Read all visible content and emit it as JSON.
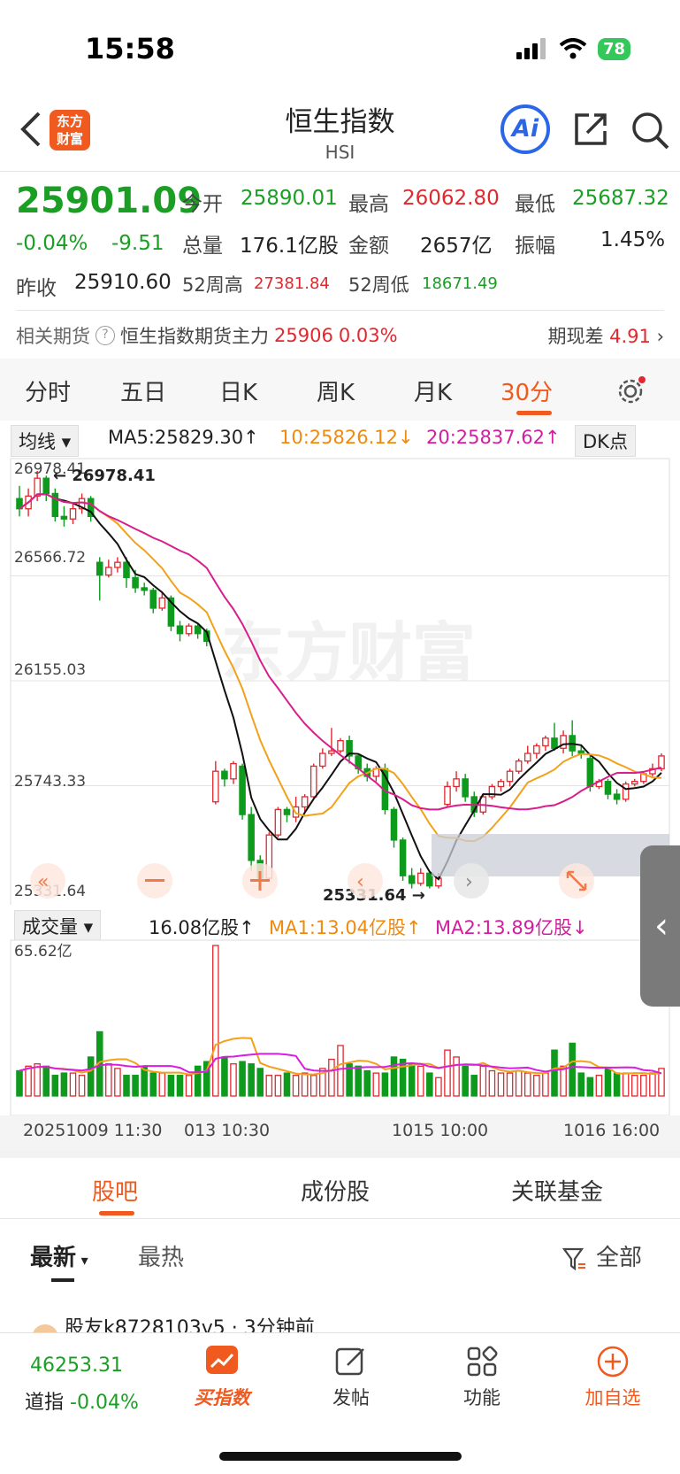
{
  "status_bar": {
    "time": "15:58",
    "battery": "78"
  },
  "header": {
    "logo_line1": "东方",
    "logo_line2": "财富",
    "title": "恒生指数",
    "subtitle": "HSI",
    "ai_label": "Ai"
  },
  "quote": {
    "price": "25901.09",
    "change_pct": "-0.04%",
    "change_abs": "-9.51",
    "open_label": "今开",
    "open": "25890.01",
    "high_label": "最高",
    "high": "26062.80",
    "low_label": "最低",
    "low": "25687.32",
    "volume_label": "总量",
    "volume": "176.1亿股",
    "amount_label": "金额",
    "amount": "2657亿",
    "amplitude_label": "振幅",
    "amplitude": "1.45%",
    "prev_close_label": "昨收",
    "prev_close": "25910.60",
    "wk52_high_label": "52周高",
    "wk52_high": "27381.84",
    "wk52_low_label": "52周低",
    "wk52_low": "18671.49"
  },
  "futures": {
    "label": "相关期货",
    "help": "?",
    "name": "恒生指数期货主力",
    "price": "25906",
    "pct": "0.03%",
    "basis_label": "期现差",
    "basis": "4.91"
  },
  "chart_tabs": [
    "分时",
    "五日",
    "日K",
    "周K",
    "月K",
    "30分"
  ],
  "indicators": {
    "ma_selector": "均线",
    "ma5": "MA5:25829.30↑",
    "ma10": "10:25826.12↓",
    "ma20": "20:25837.62↑",
    "dk": "DK点",
    "vol_selector": "成交量",
    "vol_value": "16.08亿股↑",
    "vol_ma1": "MA1:13.04亿股↑",
    "vol_ma2": "MA2:13.89亿股↓"
  },
  "chart_labels": {
    "y1": "26978.41",
    "y2": "26566.72",
    "y3": "26155.03",
    "y4": "25743.33",
    "y5": "25331.64",
    "high_marker": "26978.41",
    "low_marker": "25331.64",
    "vol_max": "65.62亿",
    "watermark": "东方财富",
    "t1": "20251009 11:30",
    "t2": "013 10:30",
    "t3": "1015 10:00",
    "t4": "1016 16:00"
  },
  "chart_data": {
    "type": "candlestick",
    "ylim": [
      25331.64,
      26978.41
    ],
    "candles": [
      [
        26870,
        26830,
        26920,
        26800
      ],
      [
        26830,
        26880,
        26910,
        26800
      ],
      [
        26880,
        26950,
        26978.41,
        26860
      ],
      [
        26950,
        26890,
        26960,
        26860
      ],
      [
        26890,
        26800,
        26910,
        26780
      ],
      [
        26800,
        26790,
        26840,
        26760
      ],
      [
        26790,
        26830,
        26850,
        26770
      ],
      [
        26830,
        26870,
        26890,
        26810
      ],
      [
        26870,
        26800,
        26880,
        26780
      ],
      [
        26620,
        26570,
        26640,
        26470
      ],
      [
        26570,
        26600,
        26630,
        26560
      ],
      [
        26600,
        26620,
        26640,
        26580
      ],
      [
        26620,
        26560,
        26640,
        26520
      ],
      [
        26560,
        26520,
        26590,
        26500
      ],
      [
        26520,
        26510,
        26540,
        26490
      ],
      [
        26510,
        26440,
        26520,
        26420
      ],
      [
        26440,
        26480,
        26500,
        26430
      ],
      [
        26480,
        26370,
        26490,
        26350
      ],
      [
        26370,
        26340,
        26390,
        26310
      ],
      [
        26340,
        26370,
        26380,
        26330
      ],
      [
        26370,
        26340,
        26380,
        26320
      ],
      [
        26350,
        26310,
        26360,
        26290
      ],
      [
        25680,
        25800,
        25840,
        25670
      ],
      [
        25800,
        25770,
        25810,
        25740
      ],
      [
        25770,
        25830,
        25840,
        25750
      ],
      [
        25820,
        25630,
        25830,
        25610
      ],
      [
        25630,
        25450,
        25660,
        25410
      ],
      [
        25450,
        25380,
        25470,
        25331.64
      ],
      [
        25380,
        25550,
        25560,
        25370
      ],
      [
        25550,
        25650,
        25660,
        25540
      ],
      [
        25650,
        25630,
        25660,
        25600
      ],
      [
        25620,
        25660,
        25700,
        25600
      ],
      [
        25660,
        25700,
        25710,
        25640
      ],
      [
        25700,
        25820,
        25830,
        25690
      ],
      [
        25820,
        25870,
        25890,
        25810
      ],
      [
        25870,
        25880,
        25970,
        25860
      ],
      [
        25880,
        25920,
        25930,
        25870
      ],
      [
        25920,
        25860,
        25940,
        25830
      ],
      [
        25860,
        25810,
        25870,
        25790
      ],
      [
        25810,
        25780,
        25830,
        25760
      ],
      [
        25780,
        25810,
        25820,
        25760
      ],
      [
        25810,
        25650,
        25830,
        25630
      ],
      [
        25650,
        25530,
        25660,
        25500
      ],
      [
        25530,
        25390,
        25540,
        25370
      ],
      [
        25390,
        25360,
        25420,
        25340
      ],
      [
        25360,
        25400,
        25420,
        25350
      ],
      [
        25400,
        25350,
        25410,
        25340
      ],
      [
        25350,
        25380,
        25400,
        25340
      ],
      [
        25670,
        25740,
        25760,
        25660
      ],
      [
        25740,
        25770,
        25800,
        25720
      ],
      [
        25770,
        25700,
        25790,
        25680
      ],
      [
        25700,
        25640,
        25720,
        25620
      ],
      [
        25640,
        25700,
        25710,
        25630
      ],
      [
        25700,
        25740,
        25750,
        25690
      ],
      [
        25740,
        25760,
        25770,
        25720
      ],
      [
        25760,
        25800,
        25810,
        25740
      ],
      [
        25800,
        25840,
        25850,
        25790
      ],
      [
        25840,
        25870,
        25900,
        25830
      ],
      [
        25870,
        25900,
        25910,
        25850
      ],
      [
        25900,
        25930,
        25940,
        25880
      ],
      [
        25930,
        25890,
        25990,
        25880
      ],
      [
        25890,
        25940,
        25960,
        25870
      ],
      [
        25940,
        25880,
        26000,
        25860
      ],
      [
        25880,
        25870,
        25900,
        25850
      ],
      [
        25850,
        25740,
        25860,
        25720
      ],
      [
        25740,
        25760,
        25770,
        25730
      ],
      [
        25760,
        25710,
        25770,
        25690
      ],
      [
        25710,
        25690,
        25730,
        25670
      ],
      [
        25690,
        25750,
        25760,
        25680
      ],
      [
        25750,
        25760,
        25770,
        25740
      ],
      [
        25760,
        25790,
        25800,
        25750
      ],
      [
        25790,
        25810,
        25830,
        25780
      ],
      [
        25810,
        25860,
        25870,
        25800
      ]
    ],
    "volume": [
      11,
      13,
      14,
      13,
      9,
      10,
      10,
      9,
      17,
      28,
      14,
      12,
      9,
      9,
      13,
      10,
      10,
      9,
      9,
      9,
      13,
      15,
      65.62,
      17,
      14,
      15,
      14,
      12,
      9,
      9,
      10,
      9,
      10,
      9,
      12,
      16,
      22,
      14,
      13,
      11,
      10,
      10,
      17,
      16,
      14,
      13,
      10,
      8,
      20,
      17,
      13,
      9,
      13,
      11,
      10,
      10,
      11,
      10,
      9,
      10,
      20,
      13,
      23,
      10,
      8,
      9,
      12,
      10,
      10,
      9,
      9,
      10,
      12
    ],
    "ma_series": [
      "MA5",
      "MA10",
      "MA20"
    ]
  },
  "section_tabs": [
    "股吧",
    "成份股",
    "关联基金"
  ],
  "filters": {
    "latest": "最新",
    "hot": "最热",
    "all": "全部"
  },
  "post_preview": "股友k8728103v5 · 3分钟前",
  "bottom_nav": {
    "index_value": "46253.31",
    "index_name": "道指",
    "index_change": "-0.04%",
    "buy_index": "买指数",
    "post": "发帖",
    "func": "功能",
    "add_watch": "加自选"
  }
}
